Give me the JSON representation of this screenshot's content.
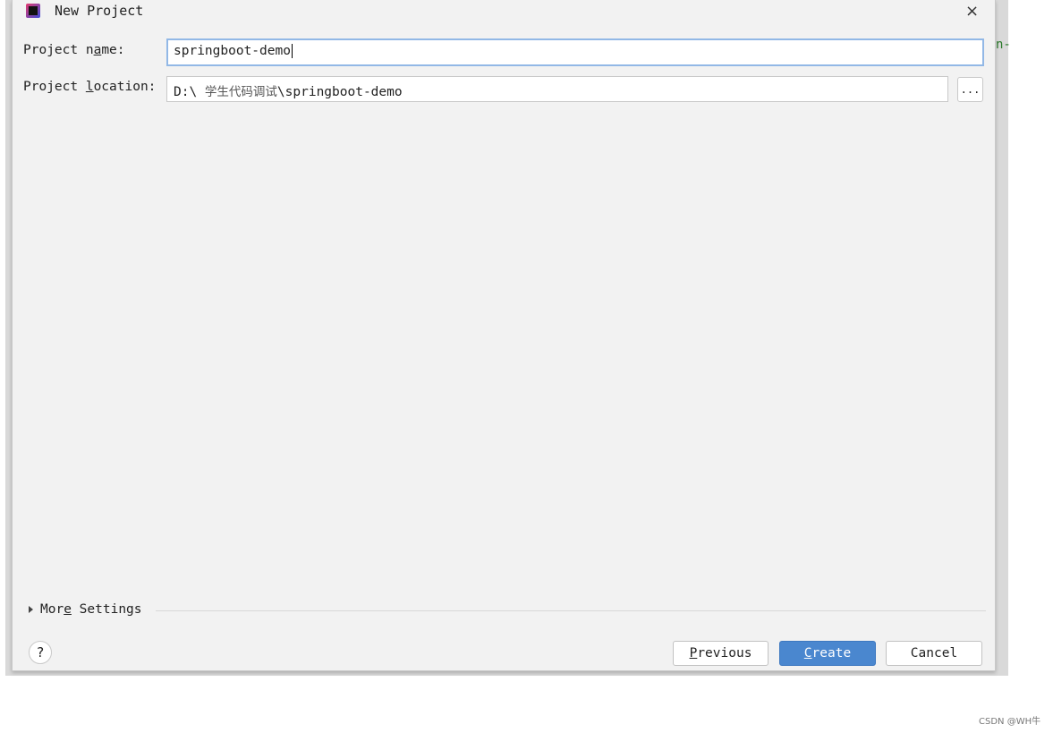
{
  "dialog": {
    "title": "New Project",
    "icon": "intellij-idea-icon",
    "close_label": "×"
  },
  "background_text": "n-",
  "form": {
    "name_label": {
      "pre": "Project n",
      "mn": "a",
      "post": "me:"
    },
    "name_value": "springboot-demo",
    "location_label": {
      "pre": "Project ",
      "mn": "l",
      "post": "ocation:"
    },
    "location_value": {
      "drive": "D:\\ ",
      "folder": "学生代码调试",
      "rest": "\\springboot-demo"
    },
    "browse_label": "..."
  },
  "more_settings": {
    "pre": "Mor",
    "mn": "e",
    "post": " Settings"
  },
  "footer": {
    "help_label": "?",
    "previous": {
      "mn": "P",
      "post": "revious"
    },
    "create": {
      "mn": "C",
      "post": "reate"
    },
    "cancel": "Cancel"
  },
  "colors": {
    "primary": "#4a87cf",
    "focus_border": "#92b8e6"
  },
  "watermark": "CSDN @WH牛"
}
